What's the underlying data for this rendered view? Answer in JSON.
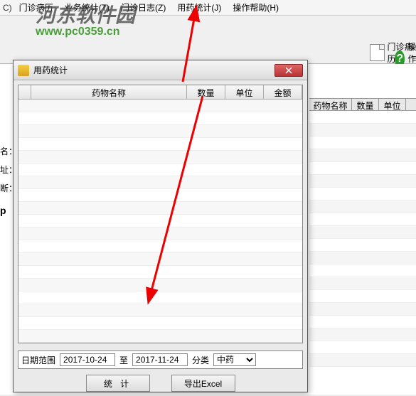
{
  "watermark": {
    "text": "河东软件园",
    "url": "www.pc0359.cn"
  },
  "menubar": {
    "items": [
      "门诊病历",
      "业务统计(T)",
      "门诊日志(Z)",
      "用药统计(J)",
      "操作帮助(H)"
    ]
  },
  "toolbar": {
    "btn1": "门诊病历",
    "btn2": "操作帮"
  },
  "bg": {
    "table_headers": [
      "药物名称",
      "数量",
      "单位"
    ],
    "left_labels": [
      "名：",
      "址：",
      "断："
    ],
    "left_p": "p"
  },
  "dialog": {
    "title": "用药统计",
    "columns": [
      "",
      "药物名称",
      "数量",
      "单位",
      "金额"
    ],
    "filter": {
      "label_range": "日期范围",
      "date_from": "2017-10-24",
      "label_to": "至",
      "date_to": "2017-11-24",
      "label_category": "分类",
      "category_value": "中药"
    },
    "buttons": {
      "stat": "统 计",
      "export": "导出Excel"
    }
  }
}
